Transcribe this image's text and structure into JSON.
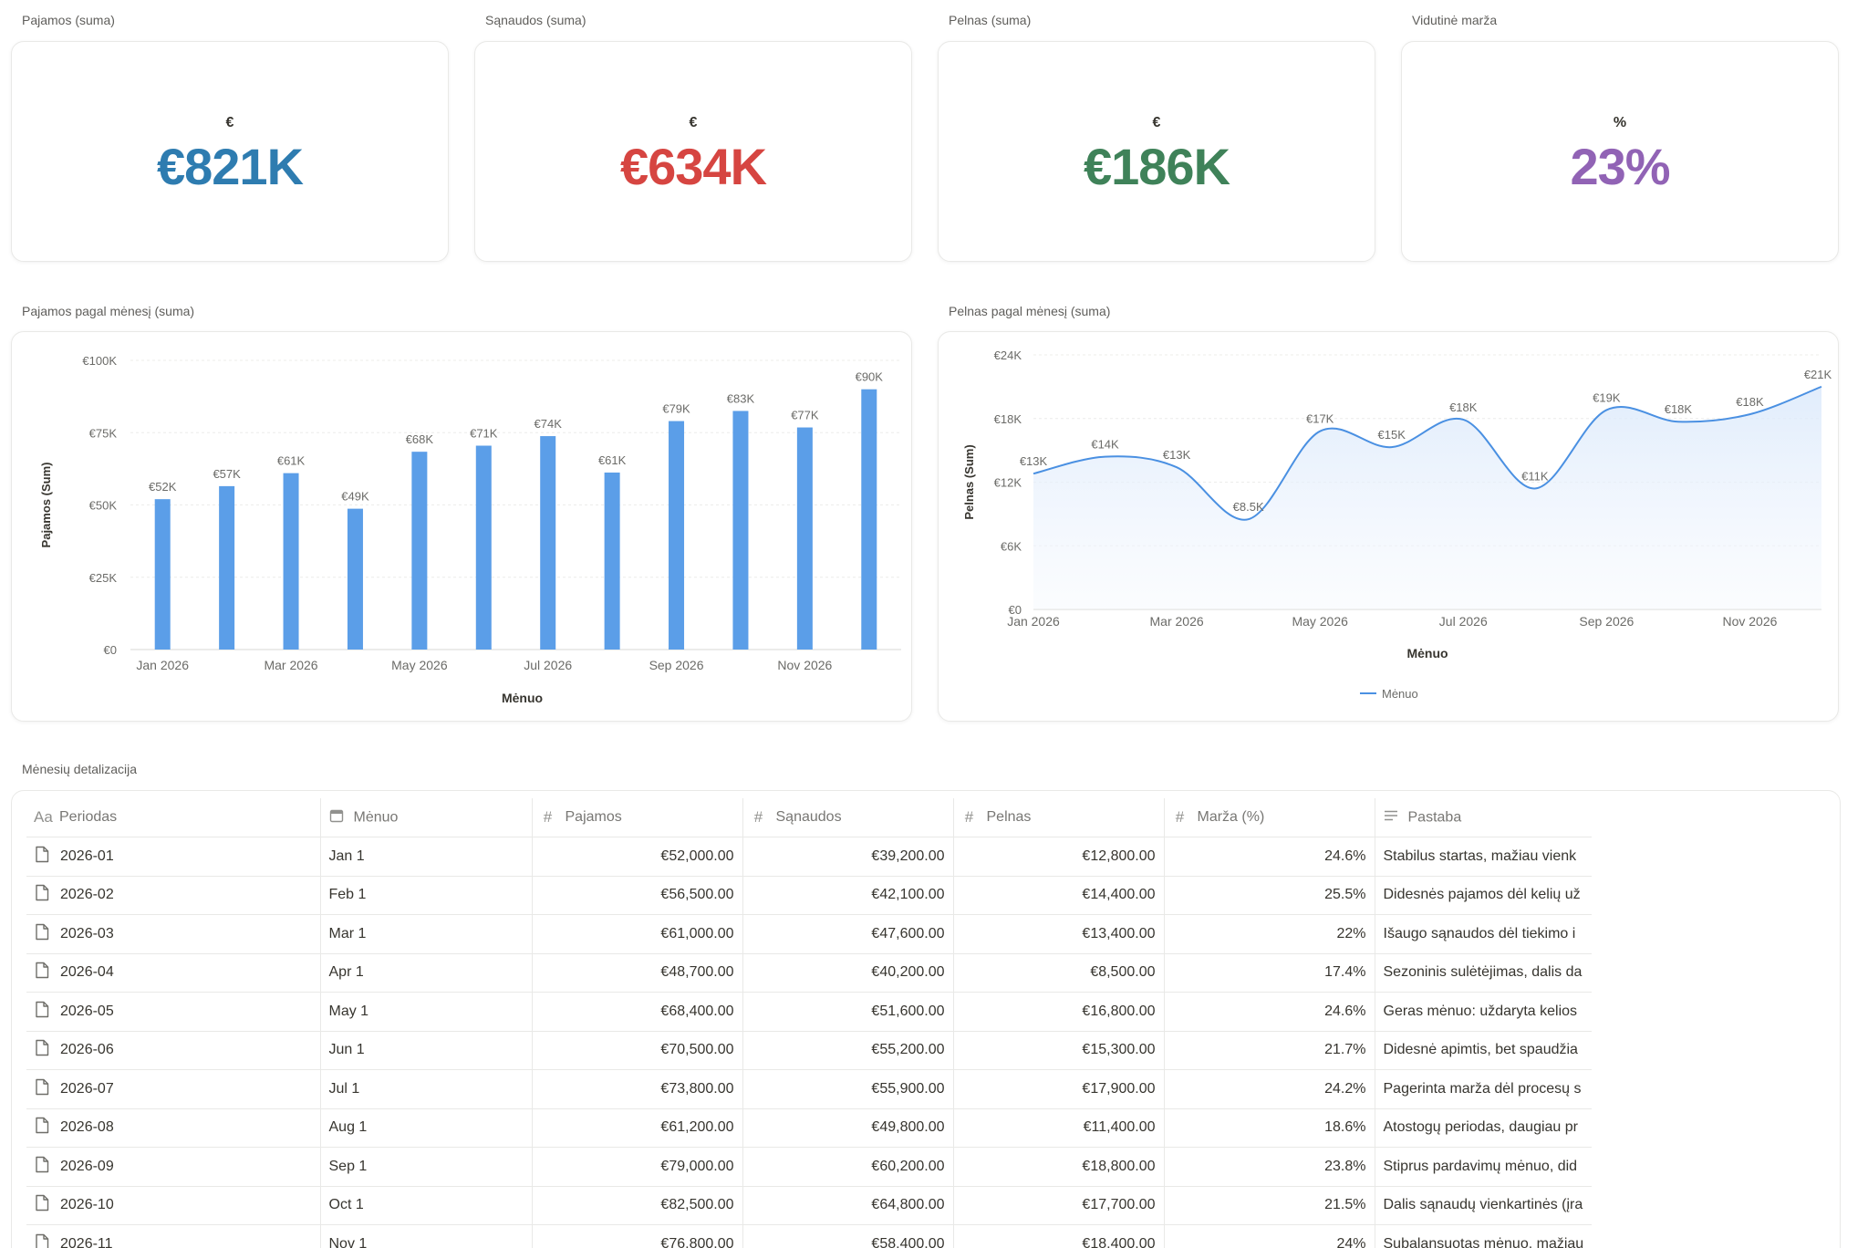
{
  "kpis": [
    {
      "label": "Pajamos (suma)",
      "unit": "€",
      "value": "€821K",
      "color": "#2e7cb0"
    },
    {
      "label": "Sąnaudos (suma)",
      "unit": "€",
      "value": "€634K",
      "color": "#d64541"
    },
    {
      "label": "Pelnas (suma)",
      "unit": "€",
      "value": "€186K",
      "color": "#3f8259"
    },
    {
      "label": "Vidutinė marža",
      "unit": "%",
      "value": "23%",
      "color": "#9163b5"
    }
  ],
  "charts_titles": {
    "bar": "Pajamos pagal mėnesį (suma)",
    "line": "Pelnas pagal mėnesį (suma)"
  },
  "chart_data": [
    {
      "type": "bar",
      "title": "Pajamos pagal mėnesį (suma)",
      "xlabel": "Mėnuo",
      "ylabel": "Pajamos (Sum)",
      "ylim": [
        0,
        100000
      ],
      "y_ticks": [
        "€0",
        "€25K",
        "€50K",
        "€75K",
        "€100K"
      ],
      "x_ticks": [
        "Jan 2026",
        "Mar 2026",
        "May 2026",
        "Jul 2026",
        "Sep 2026",
        "Nov 2026"
      ],
      "categories": [
        "Jan 2026",
        "Feb 2026",
        "Mar 2026",
        "Apr 2026",
        "May 2026",
        "Jun 2026",
        "Jul 2026",
        "Aug 2026",
        "Sep 2026",
        "Oct 2026",
        "Nov 2026",
        "Dec 2026"
      ],
      "values": [
        52000,
        56500,
        61000,
        48700,
        68400,
        70500,
        73800,
        61200,
        79000,
        82500,
        76800,
        90000
      ],
      "data_labels": [
        "€52K",
        "€57K",
        "€61K",
        "€49K",
        "€68K",
        "€71K",
        "€74K",
        "€61K",
        "€79K",
        "€83K",
        "€77K",
        "€90K"
      ],
      "color": "#5b9ee8",
      "grid": true
    },
    {
      "type": "area",
      "title": "Pelnas pagal mėnesį (suma)",
      "xlabel": "Mėnuo",
      "ylabel": "Pelnas (Sum)",
      "ylim": [
        0,
        24000
      ],
      "y_ticks": [
        "€0",
        "€6K",
        "€12K",
        "€18K",
        "€24K"
      ],
      "x_ticks": [
        "Jan 2026",
        "Mar 2026",
        "May 2026",
        "Jul 2026",
        "Sep 2026",
        "Nov 2026"
      ],
      "categories": [
        "Jan 2026",
        "Feb 2026",
        "Mar 2026",
        "Apr 2026",
        "May 2026",
        "Jun 2026",
        "Jul 2026",
        "Aug 2026",
        "Sep 2026",
        "Oct 2026",
        "Nov 2026",
        "Dec 2026"
      ],
      "series": [
        {
          "name": "Mėnuo",
          "values": [
            12800,
            14400,
            13400,
            8500,
            16800,
            15300,
            17900,
            11400,
            18800,
            17700,
            18400,
            21000
          ]
        }
      ],
      "data_labels": [
        "€13K",
        "€14K",
        "€13K",
        "€8.5K",
        "€17K",
        "€15K",
        "€18K",
        "€11K",
        "€19K",
        "€18K",
        "€18K",
        "€21K"
      ],
      "color": "#4a90e2",
      "legend": "bottom-center",
      "grid": true
    }
  ],
  "table": {
    "title": "Mėnesių detalizacija",
    "columns": [
      {
        "icon": "Aa",
        "label": "Periodas"
      },
      {
        "icon": "calendar",
        "label": "Mėnuo"
      },
      {
        "icon": "#",
        "label": "Pajamos"
      },
      {
        "icon": "#",
        "label": "Sąnaudos"
      },
      {
        "icon": "#",
        "label": "Pelnas"
      },
      {
        "icon": "#",
        "label": "Marža (%)"
      },
      {
        "icon": "text",
        "label": "Pastaba"
      }
    ],
    "rows": [
      [
        "2026-01",
        "Jan 1",
        "€52,000.00",
        "€39,200.00",
        "€12,800.00",
        "24.6%",
        "Stabilus startas, mažiau vienk"
      ],
      [
        "2026-02",
        "Feb 1",
        "€56,500.00",
        "€42,100.00",
        "€14,400.00",
        "25.5%",
        "Didesnės pajamos dėl kelių už"
      ],
      [
        "2026-03",
        "Mar 1",
        "€61,000.00",
        "€47,600.00",
        "€13,400.00",
        "22%",
        "Išaugo sąnaudos dėl tiekimo i"
      ],
      [
        "2026-04",
        "Apr 1",
        "€48,700.00",
        "€40,200.00",
        "€8,500.00",
        "17.4%",
        "Sezoninis sulėtėjimas, dalis da"
      ],
      [
        "2026-05",
        "May 1",
        "€68,400.00",
        "€51,600.00",
        "€16,800.00",
        "24.6%",
        "Geras mėnuo: uždaryta kelios"
      ],
      [
        "2026-06",
        "Jun 1",
        "€70,500.00",
        "€55,200.00",
        "€15,300.00",
        "21.7%",
        "Didesnė apimtis, bet spaudžia"
      ],
      [
        "2026-07",
        "Jul 1",
        "€73,800.00",
        "€55,900.00",
        "€17,900.00",
        "24.2%",
        "Pagerinta marža dėl procesų s"
      ],
      [
        "2026-08",
        "Aug 1",
        "€61,200.00",
        "€49,800.00",
        "€11,400.00",
        "18.6%",
        "Atostogų periodas, daugiau pr"
      ],
      [
        "2026-09",
        "Sep 1",
        "€79,000.00",
        "€60,200.00",
        "€18,800.00",
        "23.8%",
        "Stiprus pardavimų mėnuo, did"
      ],
      [
        "2026-10",
        "Oct 1",
        "€82,500.00",
        "€64,800.00",
        "€17,700.00",
        "21.5%",
        "Dalis sąnaudų vienkartinės (įra"
      ],
      [
        "2026-11",
        "Nov 1",
        "€76,800.00",
        "€58,400.00",
        "€18,400.00",
        "24%",
        "Subalansuotas mėnuo, mažiau"
      ]
    ]
  }
}
